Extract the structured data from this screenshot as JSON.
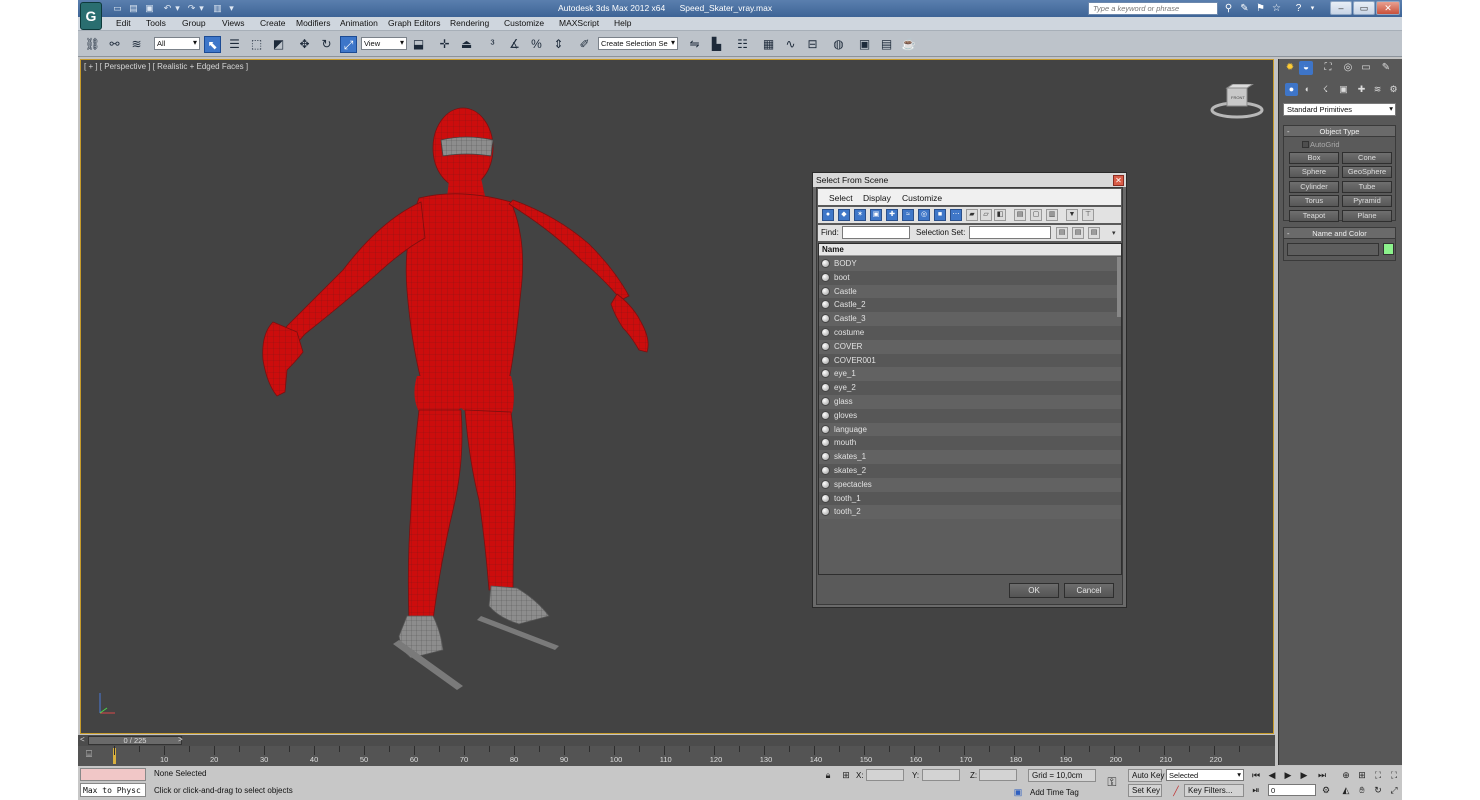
{
  "titlebar": {
    "app_name": "Autodesk 3ds Max  2012 x64",
    "file_name": "Speed_Skater_vray.max",
    "search_placeholder": "Type a keyword or phrase",
    "logo_letter": "G"
  },
  "menu": [
    "Edit",
    "Tools",
    "Group",
    "Views",
    "Create",
    "Modifiers",
    "Animation",
    "Graph Editors",
    "Rendering",
    "Customize",
    "MAXScript",
    "Help"
  ],
  "toolbar": {
    "filter_value": "All",
    "coord_value": "View",
    "selection_set_placeholder": "Create Selection Se"
  },
  "viewport": {
    "label": "[ + ] [ Perspective ] [ Realistic + Edged Faces ]",
    "model_color": "#d01010",
    "viewcube_label": "FRONT"
  },
  "dialog": {
    "title": "Select From Scene",
    "menu": [
      "Select",
      "Display",
      "Customize"
    ],
    "find_label": "Find:",
    "selection_set_label": "Selection Set:",
    "column_header": "Name",
    "objects": [
      "BODY",
      "boot",
      "Castle",
      "Castle_2",
      "Castle_3",
      "costume",
      "COVER",
      "COVER001",
      "eye_1",
      "eye_2",
      "glass",
      "gloves",
      "language",
      "mouth",
      "skates_1",
      "skates_2",
      "spectacles",
      "tooth_1",
      "tooth_2"
    ],
    "ok_label": "OK",
    "cancel_label": "Cancel"
  },
  "command_panel": {
    "category": "Standard Primitives",
    "object_type_title": "Object Type",
    "autogrid_label": "AutoGrid",
    "primitives": [
      "Box",
      "Cone",
      "Sphere",
      "GeoSphere",
      "Cylinder",
      "Tube",
      "Torus",
      "Pyramid",
      "Teapot",
      "Plane"
    ],
    "name_color_title": "Name and Color",
    "object_color": "#8cf28c"
  },
  "timeline": {
    "frame_display": "0 / 225",
    "prev_label": "<",
    "next_label": ">",
    "tick_labels": [
      "10",
      "20",
      "30",
      "40",
      "50",
      "60",
      "70",
      "80",
      "90",
      "100",
      "110",
      "120",
      "130",
      "140",
      "150",
      "160",
      "170",
      "180",
      "190",
      "200",
      "210",
      "220"
    ]
  },
  "status": {
    "maxscript_text": "Max to Physc",
    "selection_status": "None Selected",
    "prompt": "Click or click-and-drag to select objects",
    "x_label": "X:",
    "y_label": "Y:",
    "z_label": "Z:",
    "grid": "Grid = 10,0cm",
    "add_time_tag": "Add Time Tag",
    "auto_key_label": "Auto Key",
    "auto_key_value": "Selected",
    "set_key_label": "Set Key",
    "key_filters_label": "Key Filters...",
    "current_frame": "0"
  }
}
